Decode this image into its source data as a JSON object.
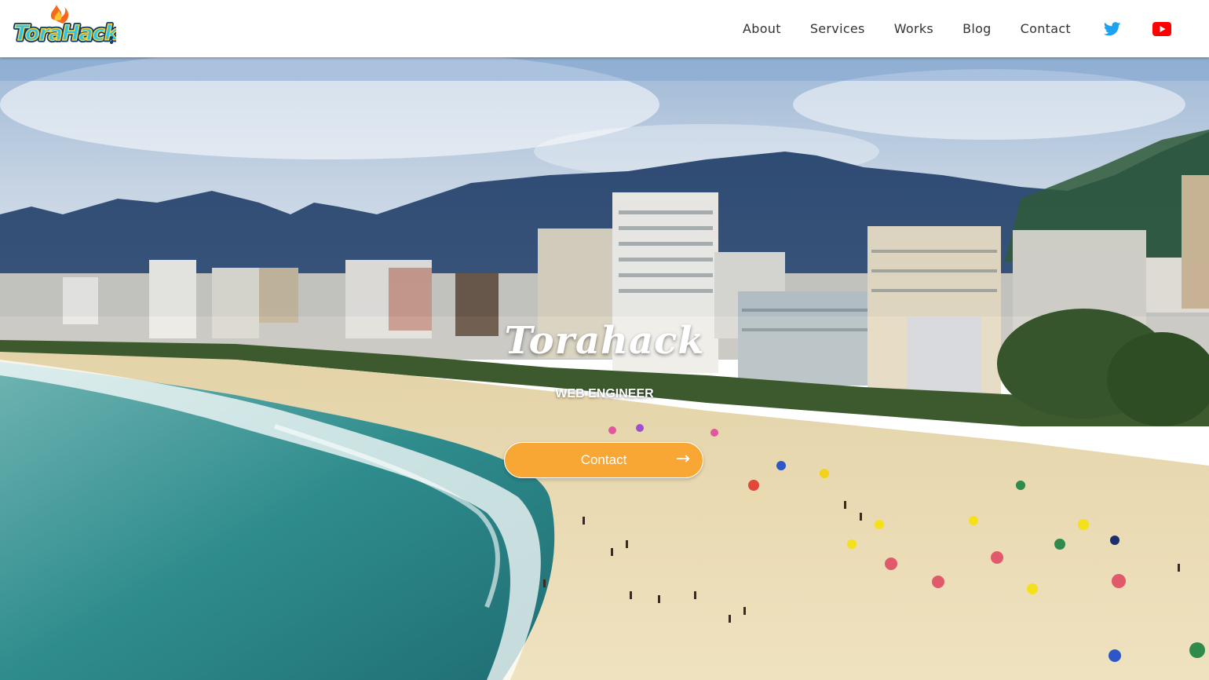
{
  "brand": {
    "logo_alt": "ToraHack"
  },
  "nav": {
    "items": [
      {
        "label": "About"
      },
      {
        "label": "Services"
      },
      {
        "label": "Works"
      },
      {
        "label": "Blog"
      },
      {
        "label": "Contact"
      }
    ],
    "social": [
      {
        "icon": "twitter-icon",
        "color": "#1da1f2"
      },
      {
        "icon": "youtube-icon",
        "color": "#ff0000"
      }
    ]
  },
  "hero": {
    "title": "Torahack",
    "subtitle": "WEB ENGINEER",
    "cta_label": "Contact",
    "cta_arrow": "→",
    "cta_color": "#f8a735"
  }
}
